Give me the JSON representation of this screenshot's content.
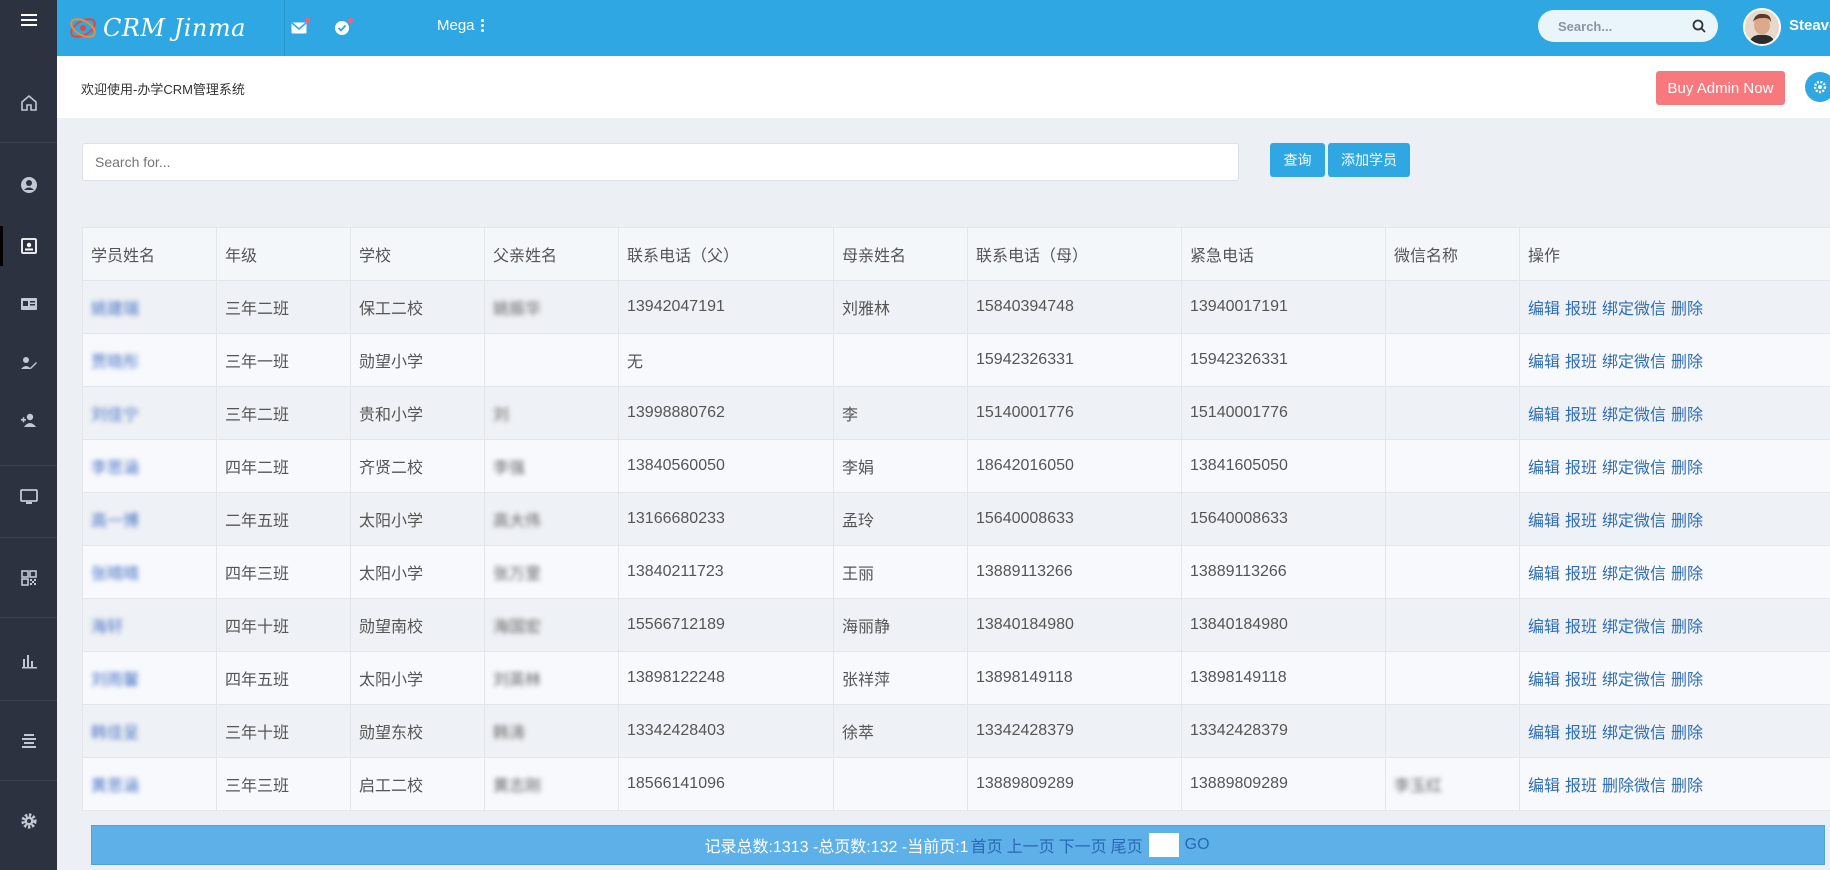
{
  "app": {
    "brand": "CRM Jinma",
    "mega_label": "Mega",
    "search_placeholder": "Search...",
    "user_name": "Steave"
  },
  "subheader": {
    "welcome": "欢迎使用-办学CRM管理系统",
    "buy_label": "Buy Admin Now"
  },
  "toolbar": {
    "search_placeholder": "Search for...",
    "query_label": "查询",
    "add_label": "添加学员"
  },
  "sidebar": {
    "items": [
      "menu-icon",
      "home-icon",
      "user-circle-icon",
      "contact-card-icon",
      "id-card-icon",
      "edit-user-icon",
      "add-user-icon",
      "monitor-icon",
      "qr-code-icon",
      "bar-chart-icon",
      "align-center-icon",
      "gear-icon"
    ]
  },
  "table": {
    "headers": [
      "学员姓名",
      "年级",
      "学校",
      "父亲姓名",
      "联系电话（父）",
      "母亲姓名",
      "联系电话（母）",
      "紧急电话",
      "微信名称",
      "操作"
    ],
    "rows": [
      {
        "name": "姚建瑞",
        "grade": "三年二班",
        "school": "保工二校",
        "father": "姚振华",
        "father_phone": "13942047191",
        "mother": "刘雅林",
        "mother_phone": "15840394748",
        "emergency": "13940017191",
        "wechat": "",
        "ops": [
          "编辑",
          "报班",
          "绑定微信",
          "删除"
        ]
      },
      {
        "name": "贾晓彤",
        "grade": "三年一班",
        "school": "勋望小学",
        "father": "",
        "father_phone": "无",
        "mother": "",
        "mother_phone": "15942326331",
        "emergency": "15942326331",
        "wechat": "",
        "ops": [
          "编辑",
          "报班",
          "绑定微信",
          "删除"
        ]
      },
      {
        "name": "刘佳宁",
        "grade": "三年二班",
        "school": "贵和小学",
        "father": "刘",
        "father_phone": "13998880762",
        "mother": "李",
        "mother_phone": "15140001776",
        "emergency": "15140001776",
        "wechat": "",
        "ops": [
          "编辑",
          "报班",
          "绑定微信",
          "删除"
        ]
      },
      {
        "name": "李思涵",
        "grade": "四年二班",
        "school": "齐贤二校",
        "father": "李强",
        "father_phone": "13840560050",
        "mother": "李娟",
        "mother_phone": "18642016050",
        "emergency": "13841605050",
        "wechat": "",
        "ops": [
          "编辑",
          "报班",
          "绑定微信",
          "删除"
        ]
      },
      {
        "name": "高一博",
        "grade": "二年五班",
        "school": "太阳小学",
        "father": "高大伟",
        "father_phone": "13166680233",
        "mother": "孟玲",
        "mother_phone": "15640008633",
        "emergency": "15640008633",
        "wechat": "",
        "ops": [
          "编辑",
          "报班",
          "绑定微信",
          "删除"
        ]
      },
      {
        "name": "张晴晴",
        "grade": "四年三班",
        "school": "太阳小学",
        "father": "张万里",
        "father_phone": "13840211723",
        "mother": "王丽",
        "mother_phone": "13889113266",
        "emergency": "13889113266",
        "wechat": "",
        "ops": [
          "编辑",
          "报班",
          "绑定微信",
          "删除"
        ]
      },
      {
        "name": "海轩",
        "grade": "四年十班",
        "school": "勋望南校",
        "father": "海国宏",
        "father_phone": "15566712189",
        "mother": "海丽静",
        "mother_phone": "13840184980",
        "emergency": "13840184980",
        "wechat": "",
        "ops": [
          "编辑",
          "报班",
          "绑定微信",
          "删除"
        ]
      },
      {
        "name": "刘雨馨",
        "grade": "四年五班",
        "school": "太阳小学",
        "father": "刘英林",
        "father_phone": "13898122248",
        "mother": "张祥萍",
        "mother_phone": "13898149118",
        "emergency": "13898149118",
        "wechat": "",
        "ops": [
          "编辑",
          "报班",
          "绑定微信",
          "删除"
        ]
      },
      {
        "name": "韩佳呈",
        "grade": "三年十班",
        "school": "勋望东校",
        "father": "韩涛",
        "father_phone": "13342428403",
        "mother": "徐萃",
        "mother_phone": "13342428379",
        "emergency": "13342428379",
        "wechat": "",
        "ops": [
          "编辑",
          "报班",
          "绑定微信",
          "删除"
        ]
      },
      {
        "name": "黄思涵",
        "grade": "三年三班",
        "school": "启工二校",
        "father": "黄志刚",
        "father_phone": "18566141096",
        "mother": "",
        "mother_phone": "13889809289",
        "emergency": "13889809289",
        "wechat": "李玉红",
        "ops": [
          "编辑",
          "报班",
          "删除微信",
          "删除"
        ]
      }
    ]
  },
  "pager": {
    "summary": "记录总数:1313 -总页数:132 -当前页:1",
    "first": "首页",
    "prev": "上一页",
    "next": "下一页",
    "last": "尾页",
    "go": "GO"
  },
  "colors": {
    "topbar": "#2fa7e2",
    "sidebar": "#2d3240",
    "buy": "#f7797d",
    "pager": "#5db0e8"
  }
}
